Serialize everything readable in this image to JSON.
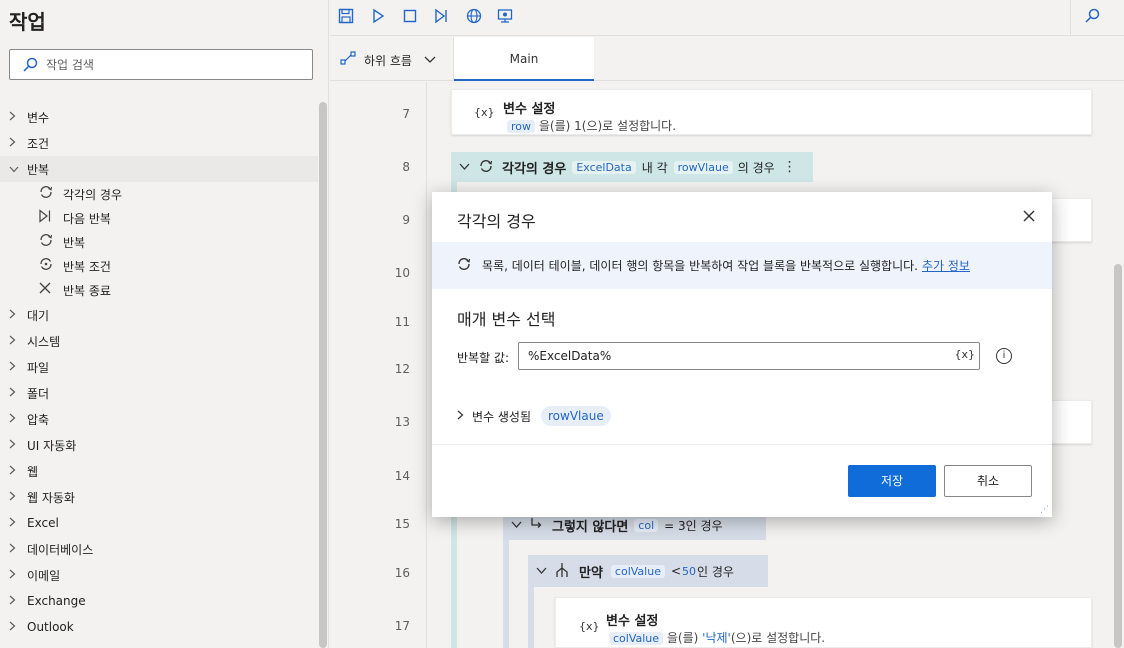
{
  "left_panel": {
    "title": "작업",
    "search_placeholder": "작업 검색",
    "tree": [
      {
        "label": "변수",
        "expanded": false
      },
      {
        "label": "조건",
        "expanded": false
      },
      {
        "label": "반복",
        "expanded": true,
        "children": [
          {
            "label": "각각의 경우",
            "icon": "loop-icon"
          },
          {
            "label": "다음 반복",
            "icon": "next-loop-icon"
          },
          {
            "label": "반복",
            "icon": "loop-icon"
          },
          {
            "label": "반복 조건",
            "icon": "loop-condition-icon"
          },
          {
            "label": "반복 종료",
            "icon": "exit-loop-icon"
          }
        ]
      },
      {
        "label": "대기",
        "expanded": false
      },
      {
        "label": "시스템",
        "expanded": false
      },
      {
        "label": "파일",
        "expanded": false
      },
      {
        "label": "폴더",
        "expanded": false
      },
      {
        "label": "압축",
        "expanded": false
      },
      {
        "label": "UI 자동화",
        "expanded": false
      },
      {
        "label": "웹",
        "expanded": false
      },
      {
        "label": "웹 자동화",
        "expanded": false
      },
      {
        "label": "Excel",
        "expanded": false
      },
      {
        "label": "데이터베이스",
        "expanded": false
      },
      {
        "label": "이메일",
        "expanded": false
      },
      {
        "label": "Exchange",
        "expanded": false
      },
      {
        "label": "Outlook",
        "expanded": false
      }
    ]
  },
  "toolbar": {
    "icons": [
      "save-icon",
      "run-icon",
      "stop-icon",
      "step-icon",
      "web-recorder-icon",
      "desktop-recorder-icon",
      "search-icon"
    ]
  },
  "tabs": {
    "subflow_label": "하위 흐름",
    "main_label": "Main"
  },
  "canvas": {
    "line_numbers": [
      "7",
      "8",
      "9",
      "10",
      "11",
      "12",
      "13",
      "14",
      "15",
      "16",
      "17"
    ],
    "step7": {
      "title": "변수 설정",
      "var": "row",
      "mid": "을(를)",
      "value": "1",
      "suffix": "(으)로 설정합니다."
    },
    "foreach": {
      "title": "각각의 경우",
      "var1": "ExcelData",
      "mid": "내 각",
      "var2": "rowVlaue",
      "suffix": "의 경우"
    },
    "else": {
      "title": "그렇지 않다면",
      "var": "col",
      "rest": "= 3인 경우"
    },
    "if": {
      "title": "만약",
      "var": "colValue",
      "op": "<",
      "value": "50",
      "suffix": "인 경우"
    },
    "step17": {
      "title": "변수 설정",
      "var": "colValue",
      "mid": "을(를)",
      "value": "'낙제'",
      "suffix": "(으)로 설정합니다."
    }
  },
  "modal": {
    "title": "각각의 경우",
    "info_text": "목록, 데이터 테이블, 데이터 행의 항목을 반복하여 작업 블록을 반복적으로 실행합니다.",
    "info_link": "추가 정보",
    "section_title": "매개 변수 선택",
    "field_label": "반복할 값:",
    "field_value": "%ExcelData%",
    "field_var_button": "{x}",
    "vars_label": "변수 생성됨",
    "vars_chip": "rowVlaue",
    "save_label": "저장",
    "cancel_label": "취소"
  }
}
